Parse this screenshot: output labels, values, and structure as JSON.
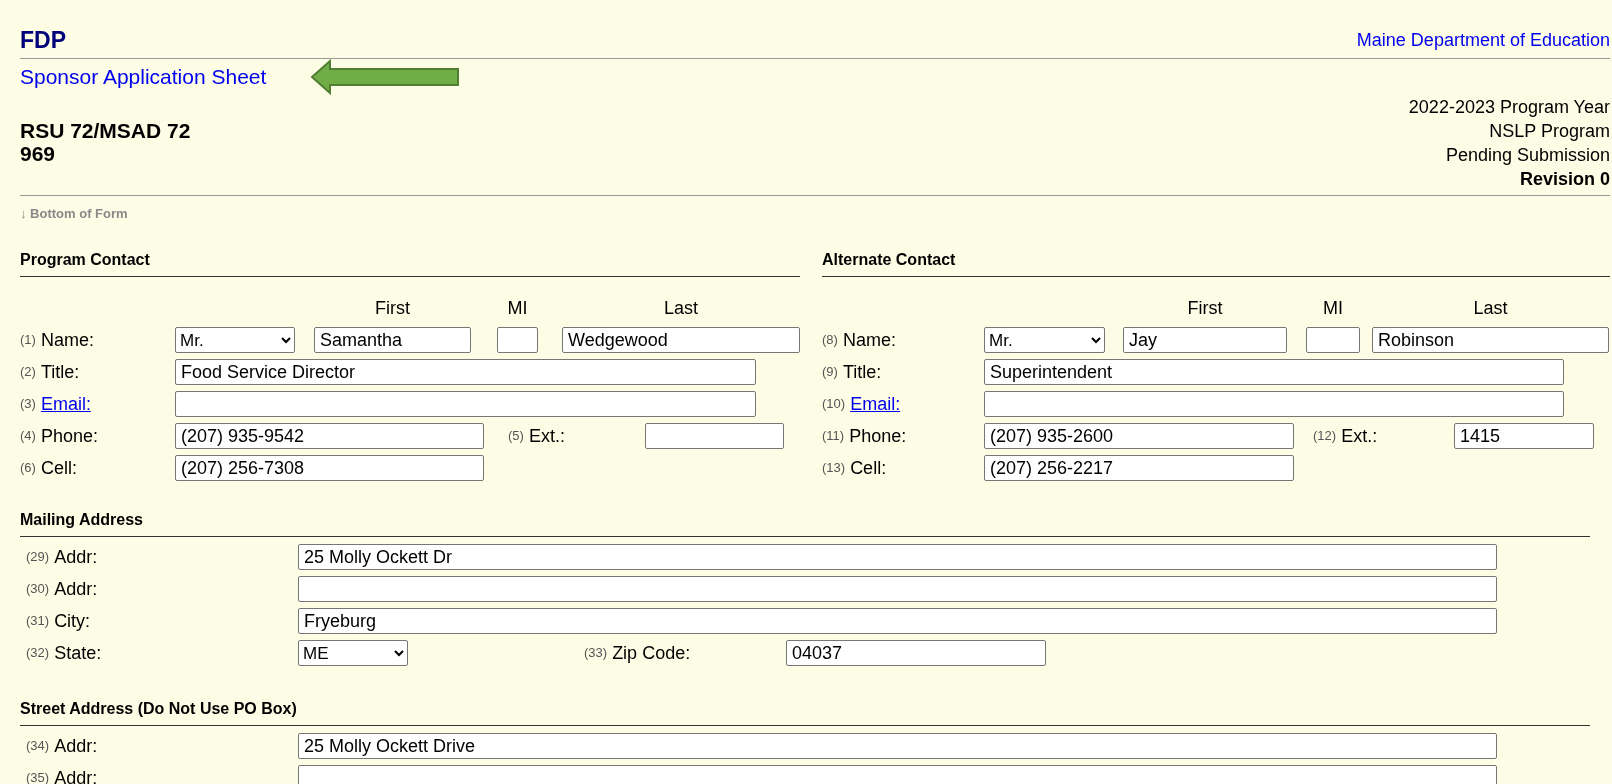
{
  "header": {
    "app": "FDP",
    "agency": "Maine Department of Education",
    "page_title": "Sponsor Application Sheet"
  },
  "sponsor": {
    "name": "RSU 72/MSAD 72",
    "number": "969"
  },
  "status_lines": [
    {
      "text": "2022-2023 Program Year",
      "bold": false
    },
    {
      "text": "NSLP Program",
      "bold": false
    },
    {
      "text": "Pending Submission",
      "bold": false
    },
    {
      "text": "Revision 0",
      "bold": true
    }
  ],
  "bottom_link": "↓ Bottom of Form",
  "contacts": [
    {
      "heading": "Program Contact",
      "column_labels": [
        "First",
        "MI",
        "Last"
      ],
      "rows": [
        {
          "kind": "name",
          "number": "(1)",
          "label": "Name:",
          "salutation": "Mr.",
          "first": "Samantha",
          "last": "Wedgewood"
        },
        {
          "kind": "text",
          "number": "(2)",
          "label": "Title:",
          "value": "Food Service Director"
        },
        {
          "kind": "email",
          "number": "(3)",
          "label": "Email:"
        },
        {
          "kind": "phone",
          "number": "(4)",
          "label": "Phone:",
          "value": "(207) 935-9542",
          "ext_number": "(5)",
          "ext_label": "Ext.:"
        },
        {
          "kind": "short",
          "number": "(6)",
          "label": "Cell:",
          "value": "(207) 256-7308"
        }
      ]
    },
    {
      "heading": "Alternate Contact",
      "column_labels": [
        "First",
        "MI",
        "Last"
      ],
      "rows": [
        {
          "kind": "name",
          "number": "(8)",
          "label": "Name:",
          "salutation": "Mr.",
          "first": "Jay",
          "last": "Robinson"
        },
        {
          "kind": "text",
          "number": "(9)",
          "label": "Title:",
          "value": "Superintendent"
        },
        {
          "kind": "email",
          "number": "(10)",
          "label": "Email:"
        },
        {
          "kind": "phone",
          "number": "(11)",
          "label": "Phone:",
          "value": "(207) 935-2600",
          "ext_number": "(12)",
          "ext_label": "Ext.:",
          "ext_value": "1415"
        },
        {
          "kind": "short",
          "number": "(13)",
          "label": "Cell:",
          "value": "(207) 256-2217"
        }
      ]
    }
  ],
  "addresses": [
    {
      "heading": "Mailing Address",
      "rows": [
        {
          "kind": "text",
          "number": "(29)",
          "label": "Addr:",
          "value": "25 Molly Ockett Dr"
        },
        {
          "kind": "text",
          "number": "(30)",
          "label": "Addr:"
        },
        {
          "kind": "text",
          "number": "(31)",
          "label": "City:",
          "value": "Fryeburg"
        },
        {
          "kind": "state",
          "number": "(32)",
          "label": "State:",
          "value": "ME",
          "zip_number": "(33)",
          "zip_label": "Zip Code:",
          "zip_value": "04037"
        }
      ]
    },
    {
      "heading": "Street Address (Do Not Use PO Box)",
      "rows": [
        {
          "kind": "text",
          "number": "(34)",
          "label": "Addr:",
          "value": "25 Molly Ockett Drive"
        },
        {
          "kind": "text",
          "number": "(35)",
          "label": "Addr:"
        }
      ]
    }
  ]
}
